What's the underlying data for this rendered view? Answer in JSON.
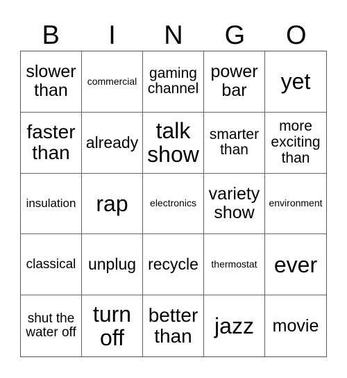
{
  "header": {
    "letters": [
      "B",
      "I",
      "N",
      "G",
      "O"
    ]
  },
  "cells": [
    "slower than",
    "commercial",
    "gaming channel",
    "power bar",
    "yet",
    "faster than",
    "already",
    "talk show",
    "smarter than",
    "more exciting than",
    "insulation",
    "rap",
    "electronics",
    "variety show",
    "environment",
    "classical",
    "unplug",
    "recycle",
    "thermostat",
    "ever",
    "shut the water off",
    "turn off",
    "better than",
    "jazz",
    "movie"
  ]
}
